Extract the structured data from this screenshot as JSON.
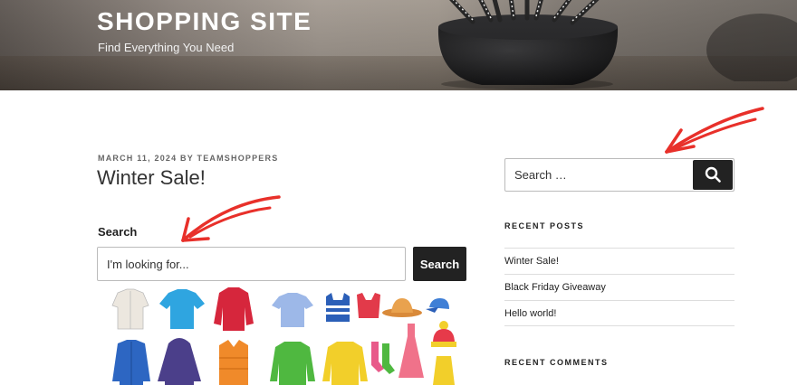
{
  "header": {
    "site_title": "SHOPPING SITE",
    "tagline": "Find Everything You Need"
  },
  "post": {
    "date": "MARCH 11, 2024",
    "by": "BY",
    "author": "TEAMSHOPPERS",
    "title": "Winter Sale!"
  },
  "search_widget": {
    "heading": "Search",
    "placeholder": "I'm looking for...",
    "button_label": "Search"
  },
  "sidebar": {
    "search_placeholder": "Search …",
    "recent_posts_title": "RECENT POSTS",
    "recent_posts": [
      {
        "label": "Winter Sale!"
      },
      {
        "label": "Black Friday Giveaway"
      },
      {
        "label": "Hello world!"
      }
    ],
    "recent_comments_title": "RECENT COMMENTS"
  },
  "icons": {
    "search": "search-icon",
    "arrow": "red-arrow-annotation"
  },
  "colors": {
    "accent_button": "#222222",
    "annotation_arrow": "#e8302a"
  }
}
